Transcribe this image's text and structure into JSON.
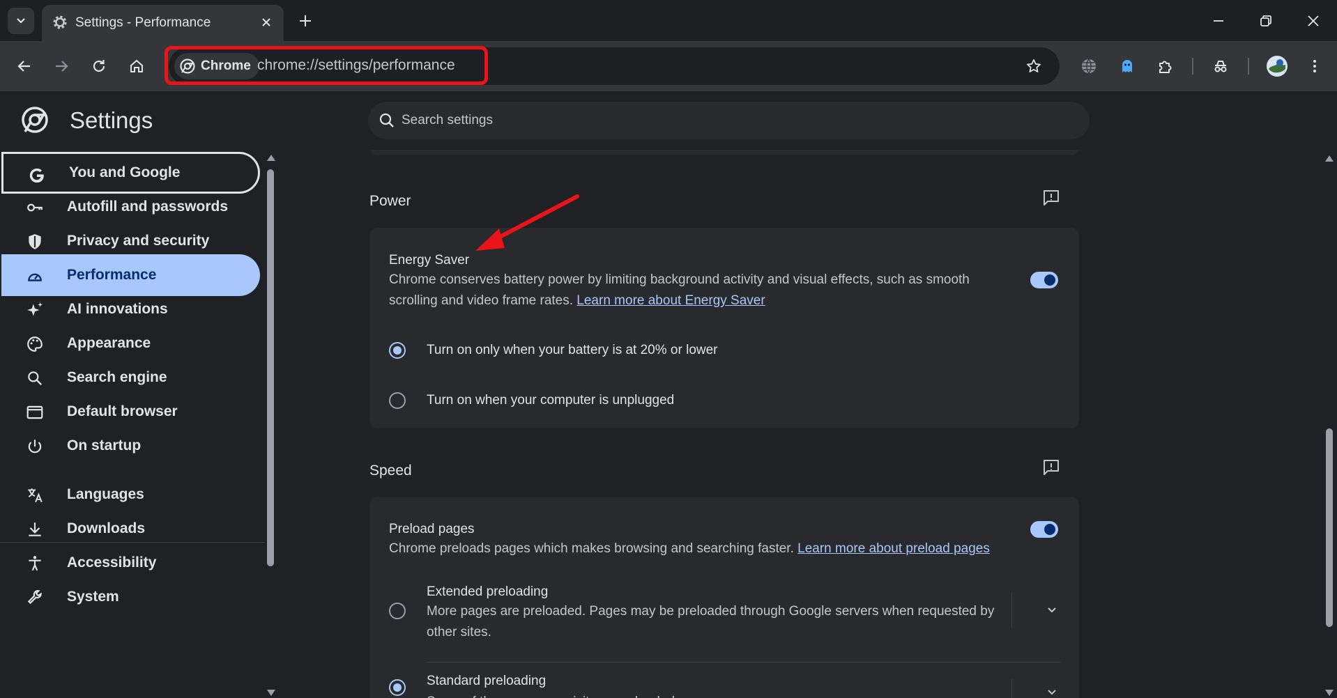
{
  "browser": {
    "tab": {
      "title": "Settings - Performance",
      "icon": "gear-icon"
    },
    "toolbar": {
      "chip_label": "Chrome",
      "url": "chrome://settings/performance"
    }
  },
  "settings": {
    "title": "Settings",
    "search_placeholder": "Search settings"
  },
  "sidebar": {
    "items": [
      {
        "label": "You and Google",
        "icon": "google-g-icon"
      },
      {
        "label": "Autofill and passwords",
        "icon": "key-icon"
      },
      {
        "label": "Privacy and security",
        "icon": "shield-icon"
      },
      {
        "label": "Performance",
        "icon": "speedometer-icon"
      },
      {
        "label": "AI innovations",
        "icon": "sparkle-icon"
      },
      {
        "label": "Appearance",
        "icon": "palette-icon"
      },
      {
        "label": "Search engine",
        "icon": "search-icon"
      },
      {
        "label": "Default browser",
        "icon": "browser-window-icon"
      },
      {
        "label": "On startup",
        "icon": "power-icon"
      },
      {
        "label": "Languages",
        "icon": "translate-icon"
      },
      {
        "label": "Downloads",
        "icon": "download-icon"
      },
      {
        "label": "Accessibility",
        "icon": "accessibility-icon"
      },
      {
        "label": "System",
        "icon": "wrench-icon"
      }
    ],
    "active": "Performance",
    "focused": "You and Google"
  },
  "power": {
    "section_title": "Power",
    "energy_saver": {
      "title": "Energy Saver",
      "description": "Chrome conserves battery power by limiting background activity and visual effects, such as smooth scrolling and video frame rates.",
      "link": "Learn more about Energy Saver",
      "enabled": true
    },
    "options": [
      {
        "label": "Turn on only when your battery is at 20% or lower",
        "selected": true
      },
      {
        "label": "Turn on when your computer is unplugged",
        "selected": false
      }
    ]
  },
  "speed": {
    "section_title": "Speed",
    "preload": {
      "title": "Preload pages",
      "description": "Chrome preloads pages which makes browsing and searching faster.",
      "link": "Learn more about preload pages",
      "enabled": true
    },
    "options": [
      {
        "title": "Extended preloading",
        "description": "More pages are preloaded. Pages may be preloaded through Google servers when requested by other sites.",
        "selected": false
      },
      {
        "title": "Standard preloading",
        "description": "Some of the pages you visit are preloaded",
        "selected": true
      }
    ]
  },
  "colors": {
    "accent": "#a8c7fa",
    "highlight_red": "#e8141a",
    "background": "#202124",
    "card": "#292a2d"
  }
}
